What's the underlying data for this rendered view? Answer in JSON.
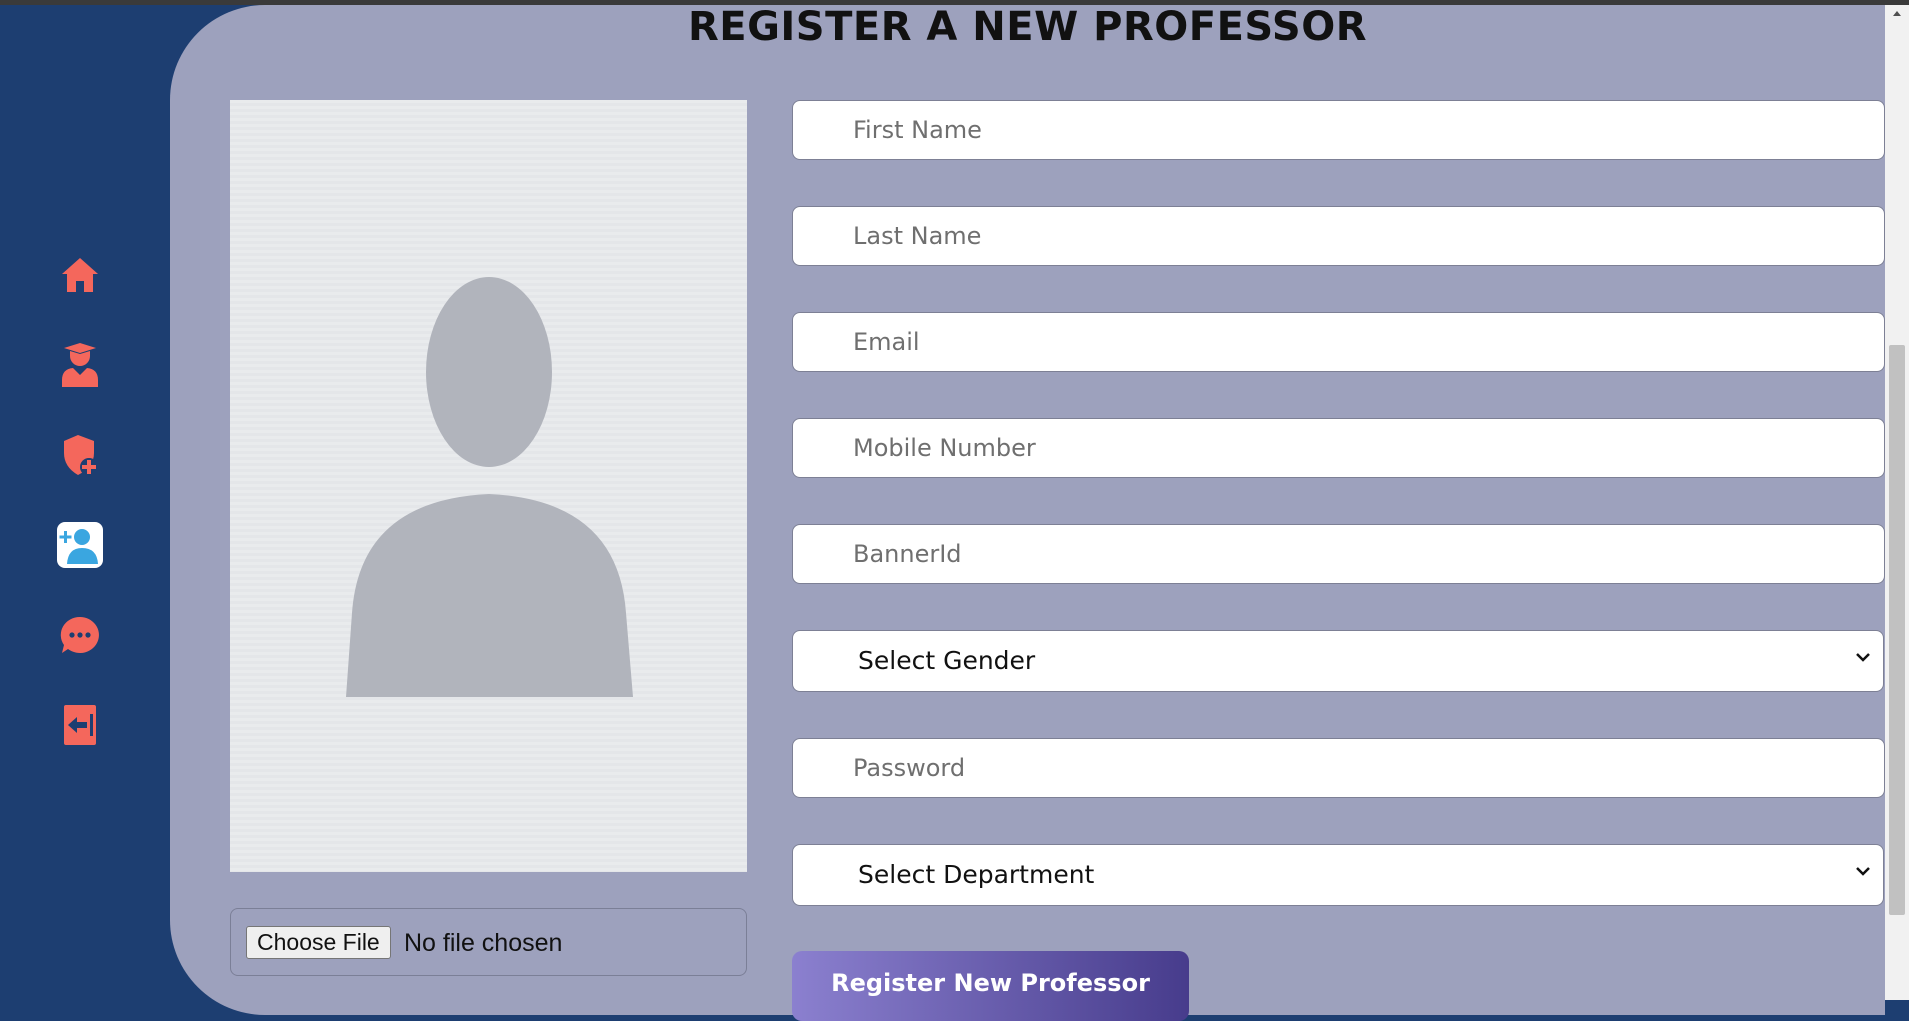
{
  "page": {
    "title": "REGISTER A NEW PROFESSOR"
  },
  "sidebar": {
    "items": [
      {
        "name": "home",
        "icon": "home-icon"
      },
      {
        "name": "professors",
        "icon": "graduate-user-icon"
      },
      {
        "name": "add-department",
        "icon": "shield-plus-icon"
      },
      {
        "name": "add-professor",
        "icon": "user-plus-icon",
        "active": true
      },
      {
        "name": "messages",
        "icon": "chat-bubble-icon"
      },
      {
        "name": "logout",
        "icon": "logout-icon"
      }
    ],
    "icon_color": "#f4675c",
    "active_icon_color": "#3aa6e0"
  },
  "form": {
    "photo_alt": "profile-placeholder",
    "file": {
      "button_label": "Choose File",
      "status": "No file chosen"
    },
    "first_name": {
      "placeholder": "First Name",
      "value": ""
    },
    "last_name": {
      "placeholder": "Last Name",
      "value": ""
    },
    "email": {
      "placeholder": "Email",
      "value": ""
    },
    "mobile": {
      "placeholder": "Mobile Number",
      "value": ""
    },
    "banner_id": {
      "placeholder": "BannerId",
      "value": ""
    },
    "gender": {
      "selected": "Select Gender"
    },
    "password": {
      "placeholder": "Password",
      "value": ""
    },
    "department": {
      "selected": "Select Department"
    },
    "submit_label": "Register New Professor"
  },
  "colors": {
    "sidebar_bg": "#1d3e71",
    "main_bg": "#9da1bd",
    "button_gradient_start": "#8b80cf",
    "button_gradient_end": "#473c8c"
  }
}
